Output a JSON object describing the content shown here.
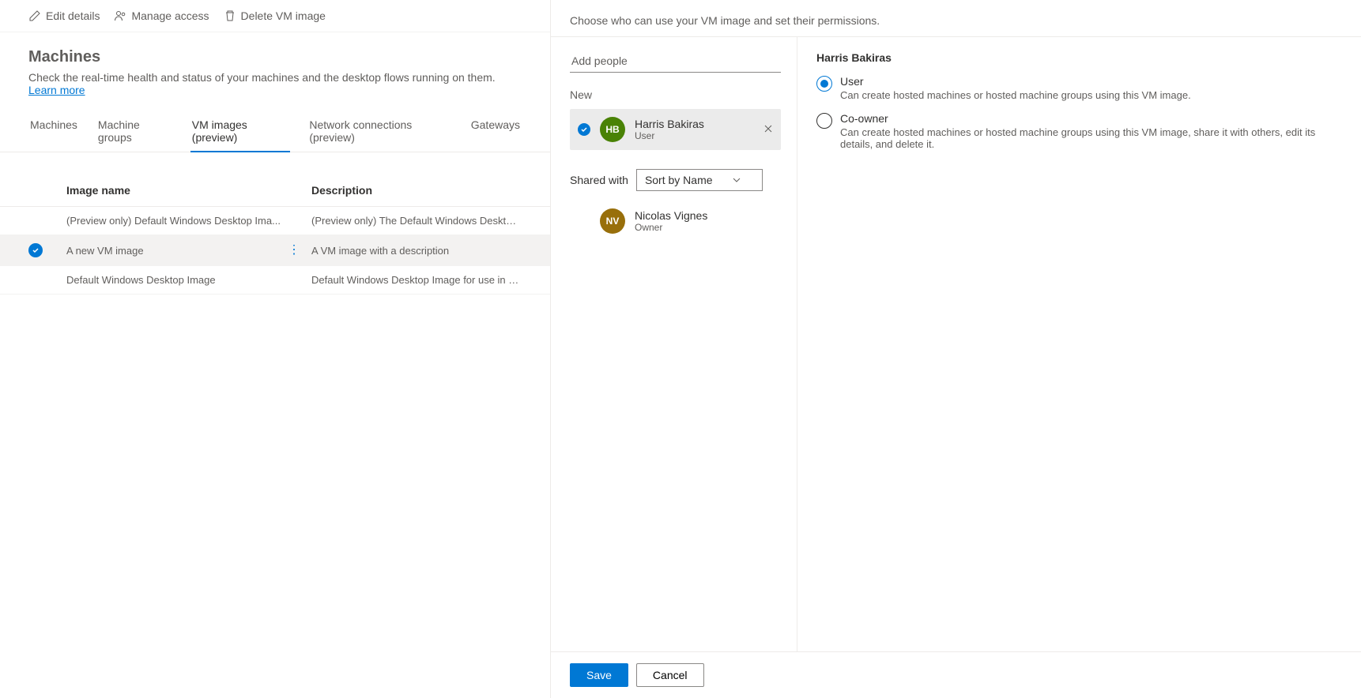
{
  "toolbar": {
    "edit": "Edit details",
    "manage": "Manage access",
    "delete": "Delete VM image"
  },
  "page": {
    "title": "Machines",
    "description": "Check the real-time health and status of your machines and the desktop flows running on them. ",
    "learn_more": "Learn more"
  },
  "tabs": {
    "machines": "Machines",
    "groups": "Machine groups",
    "vm": "VM images (preview)",
    "network": "Network connections (preview)",
    "gateways": "Gateways"
  },
  "table": {
    "header_name": "Image name",
    "header_desc": "Description",
    "rows": [
      {
        "name": "(Preview only) Default Windows Desktop Ima...",
        "desc": "(Preview only) The Default Windows Desktop Image for use i...",
        "selected": false
      },
      {
        "name": "A new VM image",
        "desc": "A VM image with a description",
        "selected": true
      },
      {
        "name": "Default Windows Desktop Image",
        "desc": "Default Windows Desktop Image for use in Microsoft Deskto...",
        "selected": false
      }
    ]
  },
  "panel": {
    "heading": "Choose who can use your VM image and set their permissions.",
    "add_placeholder": "Add people",
    "new_label": "New",
    "shared_with_label": "Shared with",
    "sort_label": "Sort by Name",
    "new_people": [
      {
        "name": "Harris Bakiras",
        "role": "User",
        "initials": "HB",
        "color": "green"
      }
    ],
    "shared_people": [
      {
        "name": "Nicolas Vignes",
        "role": "Owner",
        "initials": "NV",
        "color": "brown"
      }
    ],
    "perm_person": "Harris Bakiras",
    "permissions": [
      {
        "label": "User",
        "desc": "Can create hosted machines or hosted machine groups using this VM image.",
        "checked": true
      },
      {
        "label": "Co-owner",
        "desc": "Can create hosted machines or hosted machine groups using this VM image, share it with others, edit its details, and delete it.",
        "checked": false
      }
    ],
    "save": "Save",
    "cancel": "Cancel"
  }
}
